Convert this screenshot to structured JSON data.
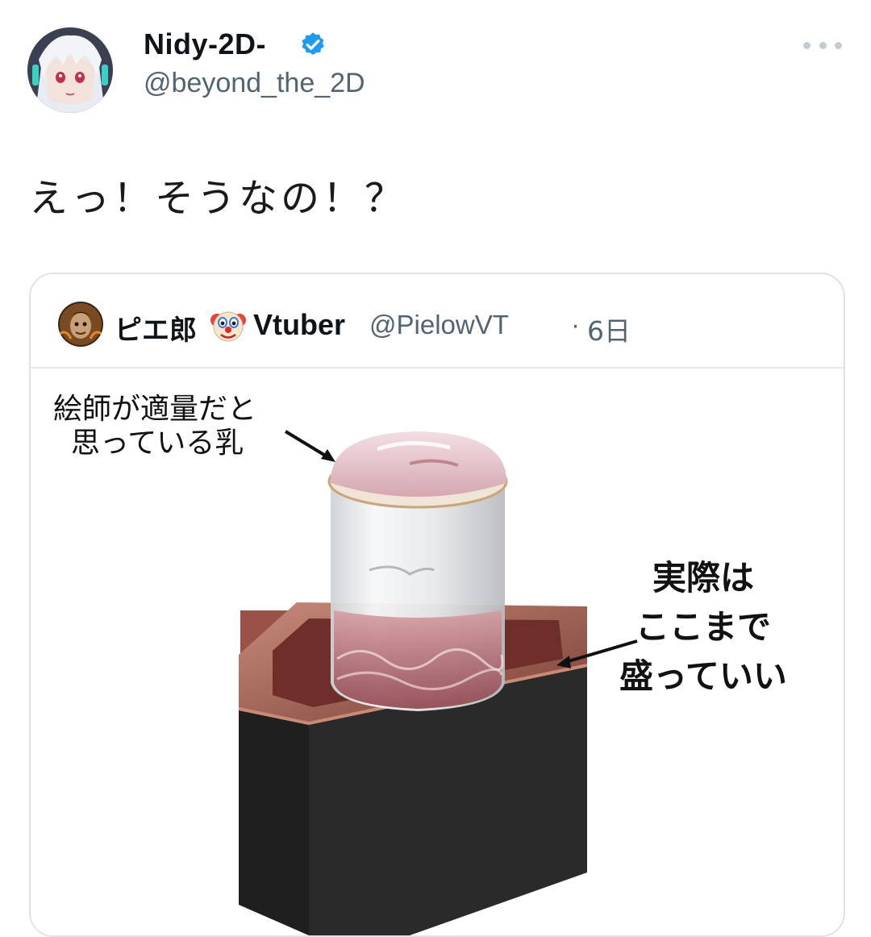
{
  "author": {
    "display_name": "Nidy-2D-",
    "handle": "@beyond_the_2D",
    "verified": true,
    "avatar_icon": "anime-girl-avatar"
  },
  "tweet": {
    "text": "えっ！そうなの！？"
  },
  "quote": {
    "display_name_part1": "ピエ郎",
    "emoji": "clown-face",
    "display_name_part2": "Vtuber",
    "handle": "@PielowVT",
    "separator": "·",
    "time": "6日",
    "image": {
      "label_top_line1": "絵師が適量だと",
      "label_top_line2": "思っている乳",
      "label_right_line1": "実際は",
      "label_right_line2": "ここまで",
      "label_right_line3": "盛っていい"
    }
  },
  "colors": {
    "verified_blue": "#1d9bf0",
    "secondary_text": "#536471",
    "border": "#dfe3e7"
  }
}
